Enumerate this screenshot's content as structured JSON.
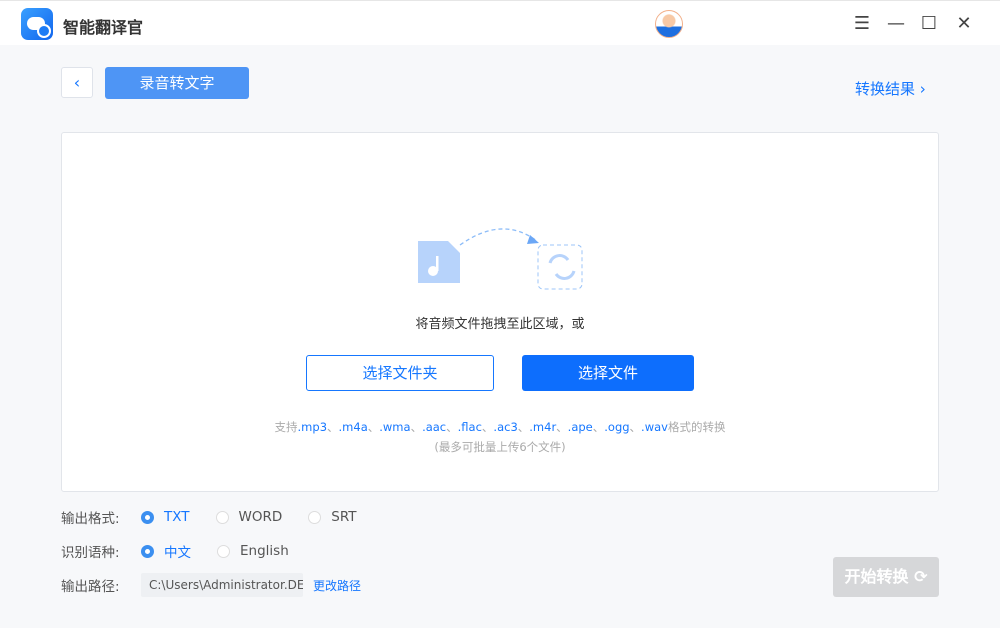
{
  "app": {
    "title": "智能翻译官"
  },
  "window": {
    "menu_icon": "☰",
    "min_icon": "—",
    "max_icon": "☐",
    "close_icon": "✕"
  },
  "header": {
    "back_icon": "‹",
    "title": "录音转文字",
    "result_link": "转换结果",
    "result_chevron": "›"
  },
  "dropzone": {
    "hint": "将音频文件拖拽至此区域，或",
    "select_folder": "选择文件夹",
    "select_file": "选择文件",
    "support_prefix": "支持",
    "formats": [
      ".mp3",
      ".m4a",
      ".wma",
      ".aac",
      ".flac",
      ".ac3",
      ".m4r",
      ".ape",
      ".ogg",
      ".wav"
    ],
    "separator": "、",
    "support_suffix": "格式的转换",
    "limit": "(最多可批量上传6个文件)"
  },
  "options": {
    "format_label": "输出格式:",
    "formats": [
      {
        "label": "TXT",
        "selected": true
      },
      {
        "label": "WORD",
        "selected": false
      },
      {
        "label": "SRT",
        "selected": false
      }
    ],
    "language_label": "识别语种:",
    "languages": [
      {
        "label": "中文",
        "selected": true
      },
      {
        "label": "English",
        "selected": false
      }
    ],
    "path_label": "输出路径:",
    "path_value": "C:\\Users\\Administrator.DE...",
    "change_path": "更改路径"
  },
  "start_button": {
    "label": "开始转换",
    "icon": "⟳"
  },
  "colors": {
    "accent": "#1677ff",
    "primary_button": "#0d6efd",
    "disabled": "#d6d7d9"
  }
}
